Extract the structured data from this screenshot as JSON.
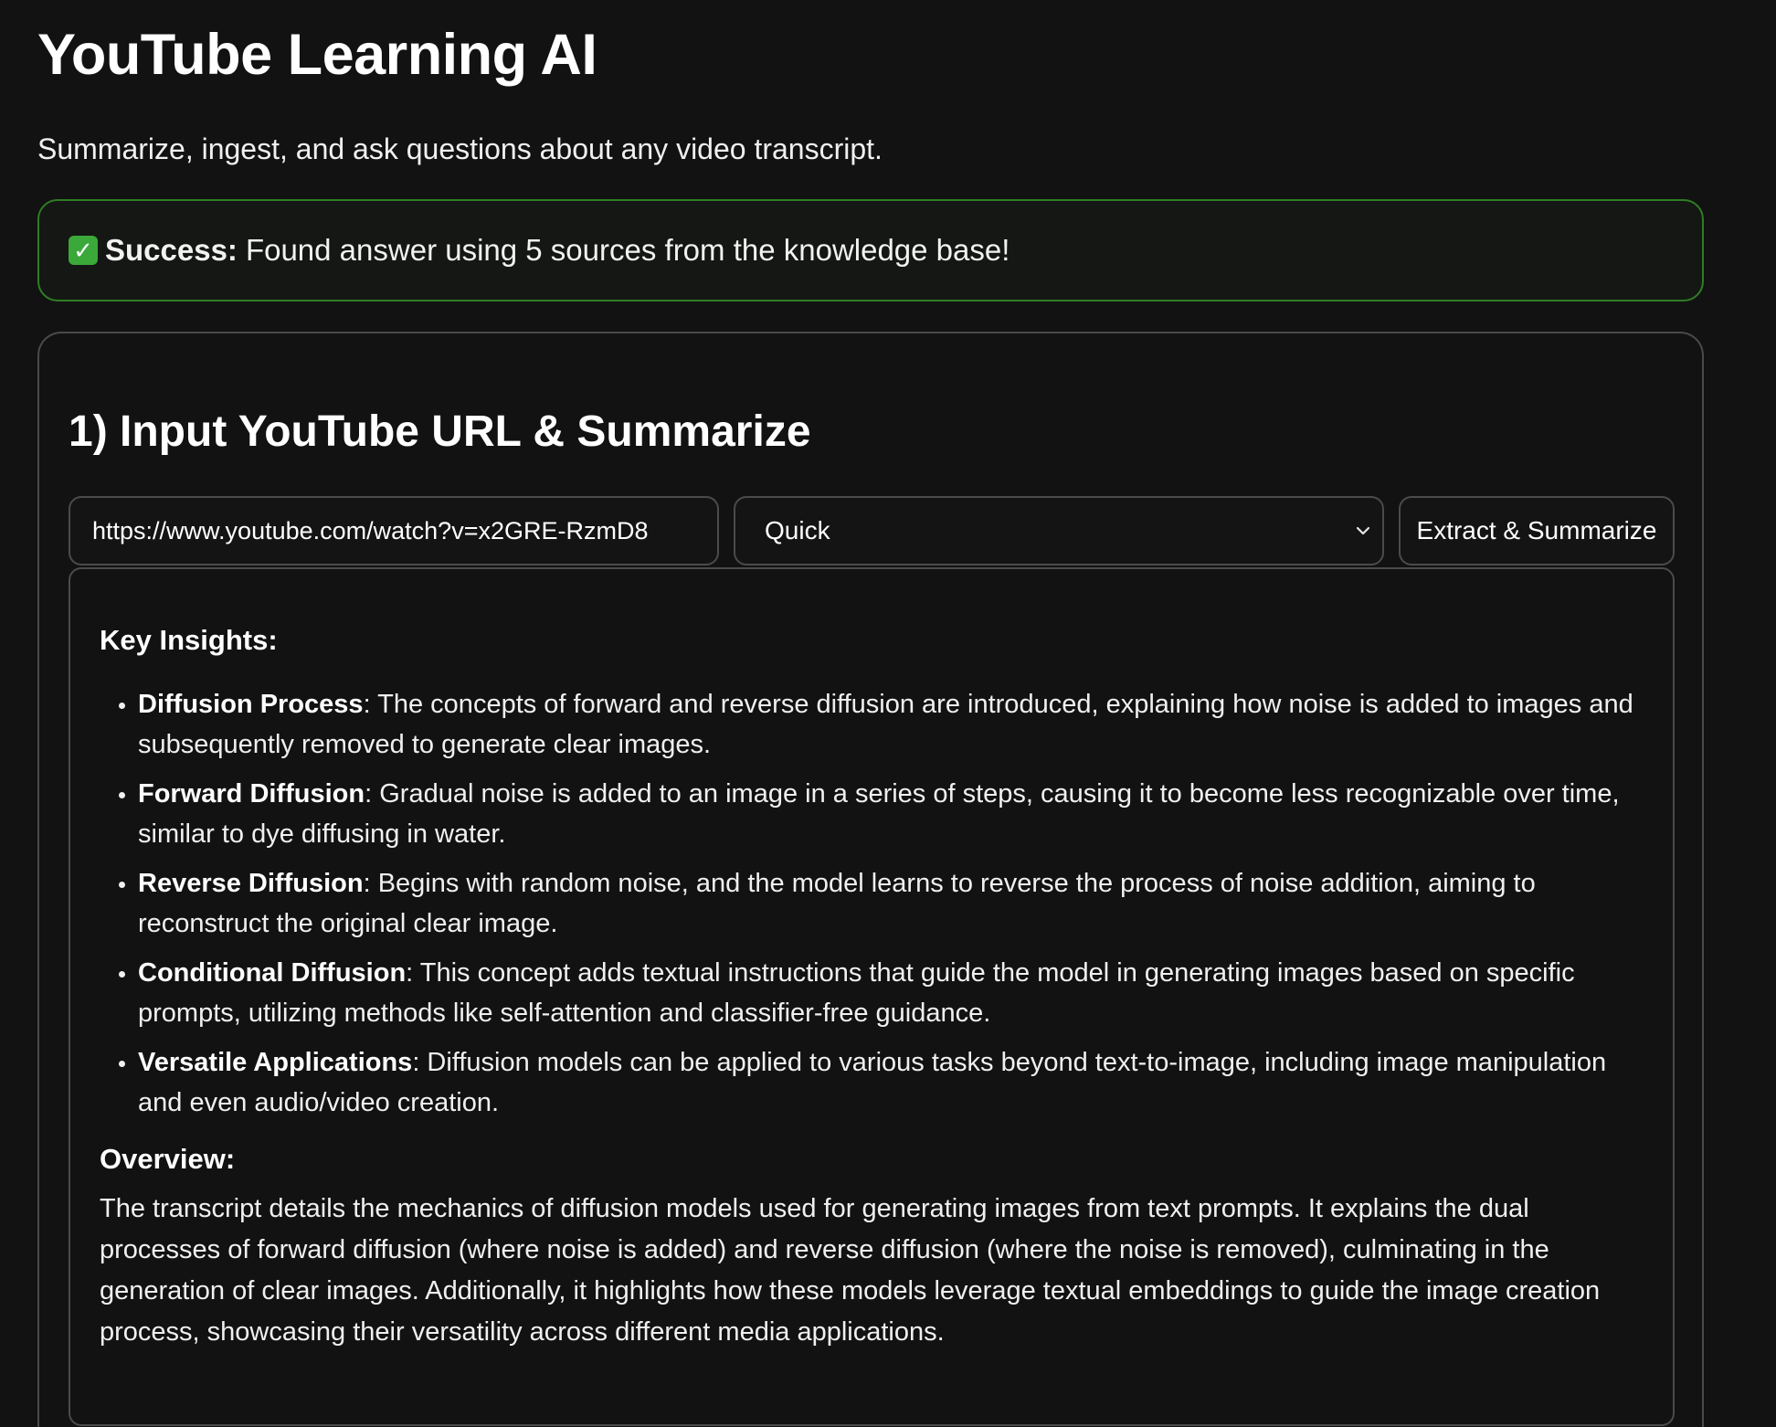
{
  "header": {
    "title": "YouTube Learning AI",
    "subtitle": "Summarize, ingest, and ask questions about any video transcript."
  },
  "alert": {
    "icon": "check-mark-icon",
    "label": "Success:",
    "message": "Found answer using 5 sources from the knowledge base!",
    "border_color": "#2f7d24"
  },
  "section1": {
    "title": "1) Input YouTube URL & Summarize",
    "url_value": "https://www.youtube.com/watch?v=x2GRE-RzmD8",
    "mode_selected": "Quick",
    "extract_label": "Extract & Summarize"
  },
  "summary": {
    "insights_heading": "Key Insights:",
    "insights": [
      {
        "term": "Diffusion Process",
        "text": ": The concepts of forward and reverse diffusion are introduced, explaining how noise is added to images and subsequently removed to generate clear images."
      },
      {
        "term": "Forward Diffusion",
        "text": ": Gradual noise is added to an image in a series of steps, causing it to become less recognizable over time, similar to dye diffusing in water."
      },
      {
        "term": "Reverse Diffusion",
        "text": ": Begins with random noise, and the model learns to reverse the process of noise addition, aiming to reconstruct the original clear image."
      },
      {
        "term": "Conditional Diffusion",
        "text": ": This concept adds textual instructions that guide the model in generating images based on specific prompts, utilizing methods like self-attention and classifier-free guidance."
      },
      {
        "term": "Versatile Applications",
        "text": ": Diffusion models can be applied to various tasks beyond text-to-image, including image manipulation and even audio/video creation."
      }
    ],
    "overview_heading": "Overview:",
    "overview_text": "The transcript details the mechanics of diffusion models used for generating images from text prompts. It explains the dual processes of forward diffusion (where noise is added) and reverse diffusion (where the noise is removed), culminating in the generation of clear images. Additionally, it highlights how these models leverage textual embeddings to guide the image creation process, showcasing their versatility across different media applications."
  }
}
